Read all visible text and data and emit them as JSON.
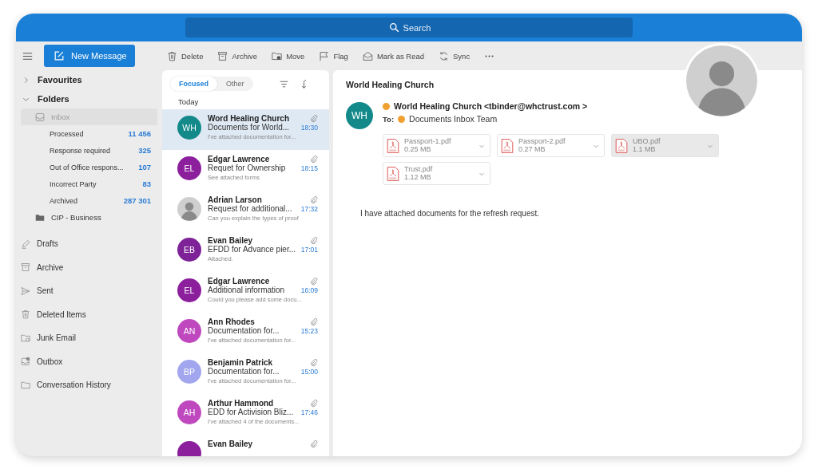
{
  "search": {
    "placeholder": "Search"
  },
  "new_message": "New Message",
  "sidebar": {
    "items": [
      {
        "kind": "group",
        "label": "Favourites",
        "expanded": false
      },
      {
        "kind": "group",
        "label": "Folders",
        "expanded": true,
        "children": [
          {
            "kind": "inbox",
            "label": "Inbox",
            "selected": true,
            "children": [
              {
                "kind": "subfolder",
                "label": "Processed",
                "count": "11 456",
                "selected": false
              },
              {
                "kind": "subfolder",
                "label": "Response required",
                "count": "325",
                "selected": false
              },
              {
                "kind": "subfolder",
                "label": "Out of Office respons...",
                "count": "107",
                "selected": false
              },
              {
                "kind": "subfolder",
                "label": "Incorrect Party",
                "count": "83",
                "selected": false
              },
              {
                "kind": "subfolder",
                "label": "Archived",
                "count": "287 301",
                "selected": false
              }
            ]
          },
          {
            "kind": "business",
            "label": "CIP - Business",
            "selected": false
          }
        ]
      },
      {
        "kind": "drafts",
        "label": "Drafts",
        "selected": false
      },
      {
        "kind": "archive",
        "label": "Archive",
        "selected": false
      },
      {
        "kind": "sent",
        "label": "Sent",
        "selected": false
      },
      {
        "kind": "deleted",
        "label": "Deleted Items",
        "selected": false
      },
      {
        "kind": "junk",
        "label": "Junk Email",
        "selected": false
      },
      {
        "kind": "outbox",
        "label": "Outbox",
        "selected": false
      },
      {
        "kind": "folder",
        "label": "Conversation History",
        "selected": false
      }
    ]
  },
  "toolbar": [
    {
      "kind": "delete",
      "label": "Delete"
    },
    {
      "kind": "archive",
      "label": "Archive"
    },
    {
      "kind": "move",
      "label": "Move"
    },
    {
      "kind": "flag",
      "label": "Flag"
    },
    {
      "kind": "read",
      "label": "Mark as Read"
    },
    {
      "kind": "sync",
      "label": "Sync"
    },
    {
      "kind": "more"
    }
  ],
  "list_tabs": [
    {
      "label": "Focused",
      "selected": true
    },
    {
      "label": "Other",
      "selected": false
    }
  ],
  "group_label": "Today",
  "messages": [
    {
      "kind": "initials",
      "initials": "WH",
      "color": "#13898a",
      "sender": "Word Healing Church",
      "subject": "Documents for World...",
      "time": "18:30",
      "preview": "I've attached documentation for...",
      "selected": true
    },
    {
      "kind": "initials",
      "initials": "EL",
      "color": "#8b1f9c",
      "sender": "Edgar Lawrence",
      "subject": "Requet for Ownership",
      "time": "18:15",
      "preview": "See attached forms",
      "selected": false
    },
    {
      "kind": "photo",
      "sender": "Adrian Larson",
      "subject": "Request for additional...",
      "time": "17:32",
      "preview": "Can you explain the types of proof",
      "selected": false
    },
    {
      "kind": "initials",
      "initials": "EB",
      "color": "#7e2297",
      "sender": "Evan Bailey",
      "subject": "EFDD for Advance pier...",
      "time": "17:01",
      "preview": "Attached.",
      "selected": false
    },
    {
      "kind": "initials",
      "initials": "EL",
      "color": "#8b1f9c",
      "sender": "Edgar Lawrence",
      "subject": "Additional information",
      "time": "16:09",
      "preview": "Could you please add some docu...",
      "selected": false
    },
    {
      "kind": "initials",
      "initials": "AN",
      "color": "#bf48bf",
      "sender": "Ann Rhodes",
      "subject": "Documentation for...",
      "time": "15:23",
      "preview": "I've attached documentation for...",
      "selected": false
    },
    {
      "kind": "initials",
      "initials": "BP",
      "color": "#a2a6ee",
      "sender": "Benjamin Patrick",
      "subject": "Documentation for...",
      "time": "15:00",
      "preview": "I've attached documentation for...",
      "selected": false
    },
    {
      "kind": "initials",
      "initials": "AH",
      "color": "#bf48bf",
      "sender": "Arthur Hammond",
      "subject": "EDD for Activision Bliz...",
      "time": "17:46",
      "preview": "I've attached 4 of the documents...",
      "selected": false
    },
    {
      "kind": "blank",
      "color": "#8b1f9c",
      "sender": "Evan Bailey",
      "selected": false
    }
  ],
  "reading": {
    "title": "World Healing Church",
    "initials": "WH",
    "from": "World Healing Church <tbinder@whctrust.com >",
    "to_label": "To:",
    "to": "Documents Inbox Team",
    "attachments": [
      {
        "name": "Passport-1.pdf",
        "size": "0.25 MB",
        "selected": false
      },
      {
        "name": "Passport-2.pdf",
        "size": "0.27 MB",
        "selected": false
      },
      {
        "name": "UBO.pdf",
        "size": "1.1 MB",
        "selected": true
      },
      {
        "name": "Trust.pdf",
        "size": "1.12 MB",
        "selected": false
      }
    ],
    "body": "I have attached documents for the refresh request."
  },
  "profile": {
    "kind": "photo"
  }
}
